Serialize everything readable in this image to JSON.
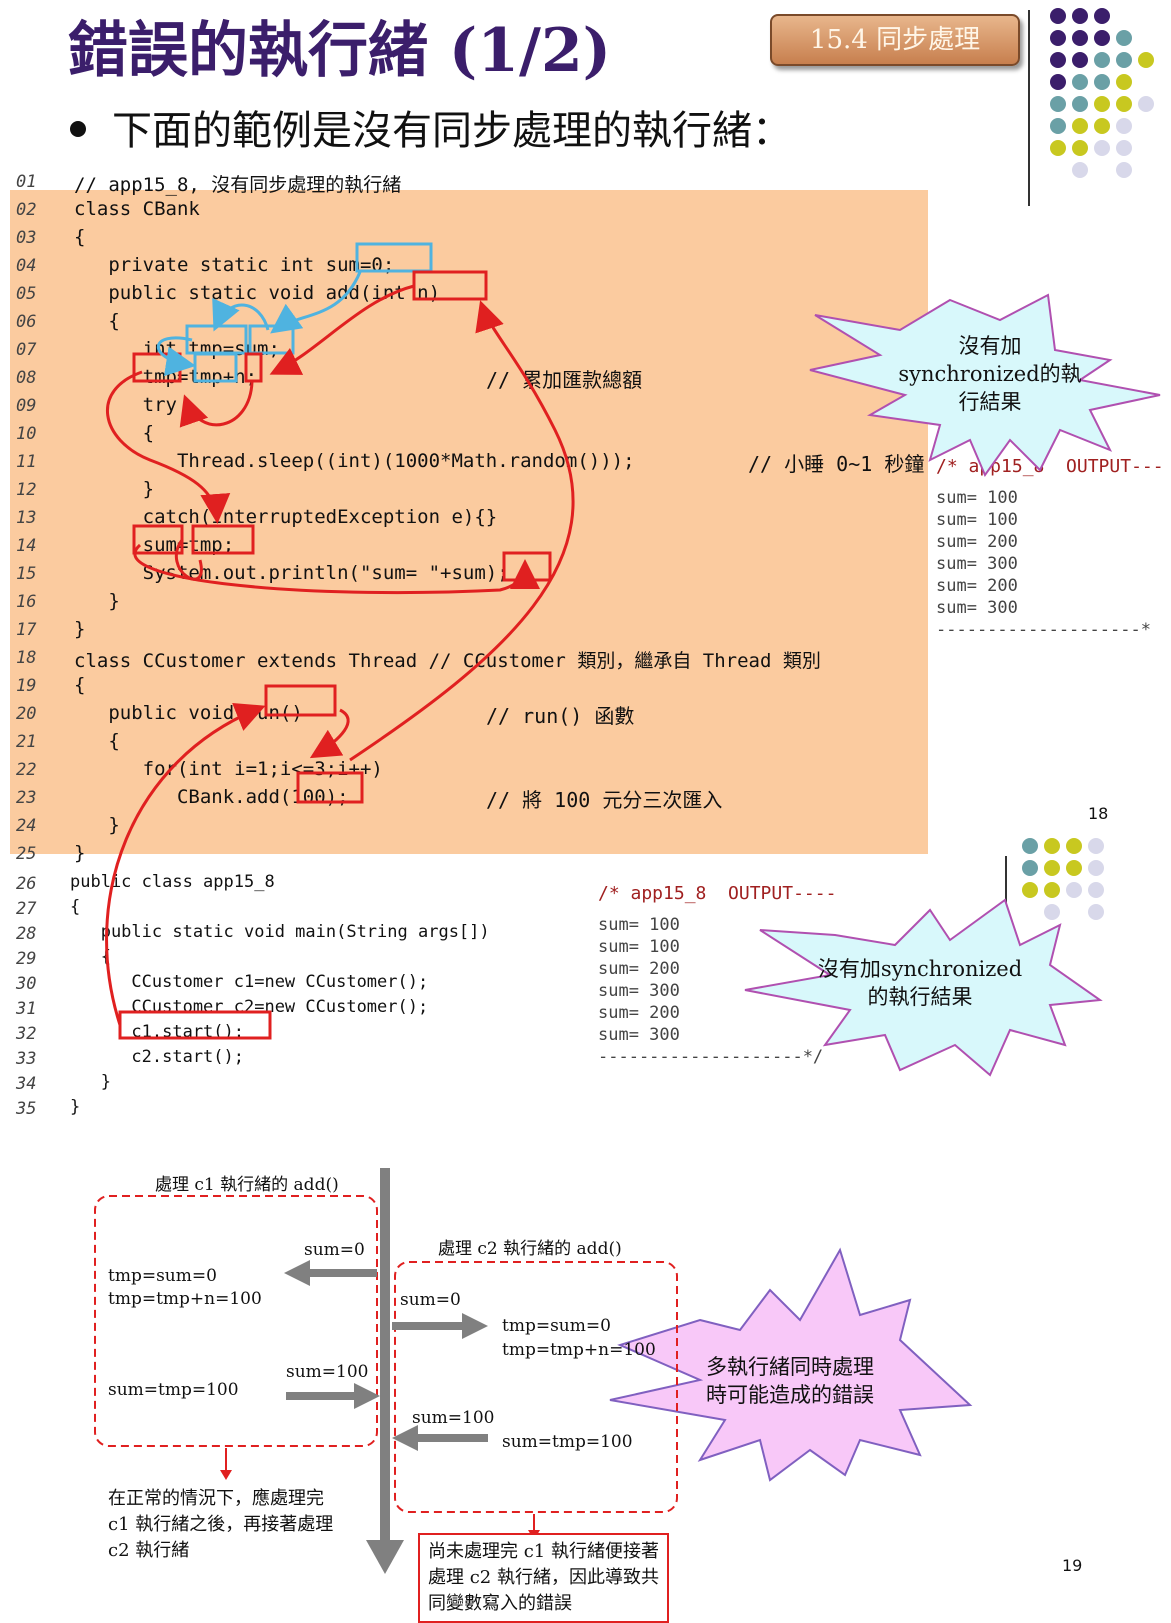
{
  "title": "錯誤的執行緒 (1/2)",
  "section_badge": "15.4  同步處理",
  "bullet": "下面的範例是沒有同步處理的執行緒：",
  "code_lines": [
    {
      "no": "01",
      "text": "// app15_8, 沒有同步處理的執行緒",
      "comment": ""
    },
    {
      "no": "02",
      "text": "class CBank",
      "comment": ""
    },
    {
      "no": "03",
      "text": "{",
      "comment": ""
    },
    {
      "no": "04",
      "text": "   private static int sum=0;",
      "comment": ""
    },
    {
      "no": "05",
      "text": "   public static void add(int n)",
      "comment": ""
    },
    {
      "no": "06",
      "text": "   {",
      "comment": ""
    },
    {
      "no": "07",
      "text": "      int tmp=sum;",
      "comment": ""
    },
    {
      "no": "08",
      "text": "      tmp=tmp+n;",
      "comment": "// 累加匯款總額"
    },
    {
      "no": "09",
      "text": "      try",
      "comment": ""
    },
    {
      "no": "10",
      "text": "      {",
      "comment": ""
    },
    {
      "no": "11",
      "text": "         Thread.sleep((int)(1000*Math.random()));",
      "comment": "// 小睡 0~1 秒鐘"
    },
    {
      "no": "12",
      "text": "      }",
      "comment": ""
    },
    {
      "no": "13",
      "text": "      catch(InterruptedException e){}",
      "comment": ""
    },
    {
      "no": "14",
      "text": "      sum=tmp;",
      "comment": ""
    },
    {
      "no": "15",
      "text": "      System.out.println(\"sum= \"+sum);",
      "comment": ""
    },
    {
      "no": "16",
      "text": "   }",
      "comment": ""
    },
    {
      "no": "17",
      "text": "}",
      "comment": ""
    },
    {
      "no": "18",
      "text": "class CCustomer extends Thread // CCustomer 類別，繼承自 Thread 類別",
      "comment": ""
    },
    {
      "no": "19",
      "text": "{",
      "comment": ""
    },
    {
      "no": "20",
      "text": "   public void run()",
      "comment": "// run() 函數"
    },
    {
      "no": "21",
      "text": "   {",
      "comment": ""
    },
    {
      "no": "22",
      "text": "      for(int i=1;i<=3;i++)",
      "comment": ""
    },
    {
      "no": "23",
      "text": "         CBank.add(100);",
      "comment": "// 將 100 元分三次匯入"
    },
    {
      "no": "24",
      "text": "   }",
      "comment": ""
    },
    {
      "no": "25",
      "text": "}",
      "comment": ""
    },
    {
      "no": "26",
      "text": "public class app15_8",
      "comment": ""
    },
    {
      "no": "27",
      "text": "{",
      "comment": ""
    },
    {
      "no": "28",
      "text": "   public static void main(String args[])",
      "comment": ""
    },
    {
      "no": "29",
      "text": "   {",
      "comment": ""
    },
    {
      "no": "30",
      "text": "      CCustomer c1=new CCustomer();",
      "comment": ""
    },
    {
      "no": "31",
      "text": "      CCustomer c2=new CCustomer();",
      "comment": ""
    },
    {
      "no": "32",
      "text": "      c1.start();",
      "comment": ""
    },
    {
      "no": "33",
      "text": "      c2.start();",
      "comment": ""
    },
    {
      "no": "34",
      "text": "   }",
      "comment": ""
    },
    {
      "no": "35",
      "text": "}",
      "comment": ""
    }
  ],
  "output1": {
    "header": "/* app15_8  OUTPUT---",
    "lines": [
      "sum= 100",
      "sum= 100",
      "sum= 200",
      "sum= 300",
      "sum= 200",
      "sum= 300"
    ],
    "footer": "--------------------*"
  },
  "output2": {
    "header": "/* app15_8  OUTPUT----",
    "lines": [
      "sum= 100",
      "sum= 100",
      "sum= 200",
      "sum= 300",
      "sum= 200",
      "sum= 300"
    ],
    "footer": "--------------------*/"
  },
  "burst1": {
    "line1": "沒有加",
    "line2": "synchronized的執",
    "line3": "行結果"
  },
  "burst2": {
    "line1": "沒有加synchronized",
    "line2": "的執行結果"
  },
  "burst3": {
    "line1": "多執行緒同時處理",
    "line2": "時可能造成的錯誤"
  },
  "page_numbers": {
    "p1": "18",
    "p2": "19"
  },
  "diagram": {
    "c1_label": "處理 c1 執行緒的 add()",
    "c2_label": "處理 c2 執行緒的 add()",
    "c1_sum0": "sum=0",
    "c1_step1": "tmp=sum=0",
    "c1_step2": "tmp=tmp+n=100",
    "c1_sum100": "sum=100",
    "c1_step3": "sum=tmp=100",
    "c2_sum0": "sum=0",
    "c2_step1": "tmp=sum=0",
    "c2_step2": "tmp=tmp+n=100",
    "c2_sum100": "sum=100",
    "c2_step3": "sum=tmp=100",
    "note_normal": [
      "在正常的情況下，應處理完",
      "c1 執行緒之後，再接著處理",
      "c2 執行緒"
    ],
    "note_error": [
      "尚未處理完 c1 執行緒便接著",
      "處理 c2 執行緒，因此導致共",
      "同變數寫入的錯誤"
    ]
  },
  "colors": {
    "title": "#3b1e6b",
    "code_bg": "#fbcb9f",
    "highlight_red": "#e02020",
    "highlight_blue": "#4fb3e0",
    "burst_cyan": "#d8f8fb",
    "burst_pink": "#f8c8f8"
  }
}
